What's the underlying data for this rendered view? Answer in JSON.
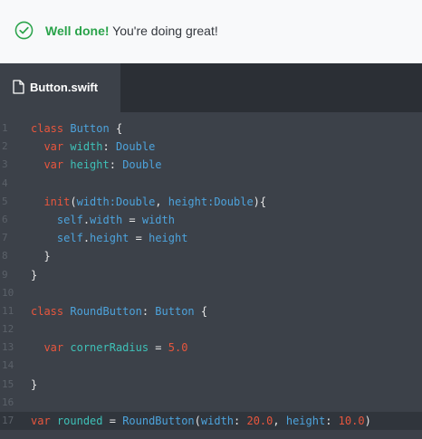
{
  "banner": {
    "strong": "Well done!",
    "message": " You're doing great!",
    "icon": "check-circle-icon",
    "accent_color": "#2aa34a"
  },
  "editor": {
    "tab": {
      "label": "Button.swift",
      "icon": "file-icon"
    },
    "active_line": 17,
    "lines": [
      {
        "n": "1",
        "tokens": [
          [
            "k",
            "class"
          ],
          [
            "p",
            " "
          ],
          [
            "t",
            "Button"
          ],
          [
            "p",
            " {"
          ]
        ]
      },
      {
        "n": "2",
        "tokens": [
          [
            "p",
            "  "
          ],
          [
            "k",
            "var"
          ],
          [
            "p",
            " "
          ],
          [
            "v",
            "width"
          ],
          [
            "p",
            ": "
          ],
          [
            "t",
            "Double"
          ]
        ]
      },
      {
        "n": "3",
        "tokens": [
          [
            "p",
            "  "
          ],
          [
            "k",
            "var"
          ],
          [
            "p",
            " "
          ],
          [
            "v",
            "height"
          ],
          [
            "p",
            ": "
          ],
          [
            "t",
            "Double"
          ]
        ]
      },
      {
        "n": "4",
        "tokens": []
      },
      {
        "n": "5",
        "tokens": [
          [
            "p",
            "  "
          ],
          [
            "k",
            "init"
          ],
          [
            "p",
            "("
          ],
          [
            "t",
            "width:Double"
          ],
          [
            "p",
            ", "
          ],
          [
            "t",
            "height:Double"
          ],
          [
            "p",
            "){"
          ]
        ]
      },
      {
        "n": "6",
        "tokens": [
          [
            "p",
            "    "
          ],
          [
            "t",
            "self"
          ],
          [
            "p",
            "."
          ],
          [
            "t",
            "width"
          ],
          [
            "p",
            " = "
          ],
          [
            "t",
            "width"
          ]
        ]
      },
      {
        "n": "7",
        "tokens": [
          [
            "p",
            "    "
          ],
          [
            "t",
            "self"
          ],
          [
            "p",
            "."
          ],
          [
            "t",
            "height"
          ],
          [
            "p",
            " = "
          ],
          [
            "t",
            "height"
          ]
        ]
      },
      {
        "n": "8",
        "tokens": [
          [
            "p",
            "  }"
          ]
        ]
      },
      {
        "n": "9",
        "tokens": [
          [
            "p",
            "}"
          ]
        ]
      },
      {
        "n": "10",
        "tokens": []
      },
      {
        "n": "11",
        "tokens": [
          [
            "k",
            "class"
          ],
          [
            "p",
            " "
          ],
          [
            "t",
            "RoundButton"
          ],
          [
            "p",
            ": "
          ],
          [
            "t",
            "Button"
          ],
          [
            "p",
            " {"
          ]
        ]
      },
      {
        "n": "12",
        "tokens": []
      },
      {
        "n": "13",
        "tokens": [
          [
            "p",
            "  "
          ],
          [
            "k",
            "var"
          ],
          [
            "p",
            " "
          ],
          [
            "v",
            "cornerRadius"
          ],
          [
            "p",
            " = "
          ],
          [
            "n",
            "5.0"
          ]
        ]
      },
      {
        "n": "14",
        "tokens": []
      },
      {
        "n": "15",
        "tokens": [
          [
            "p",
            "}"
          ]
        ]
      },
      {
        "n": "16",
        "tokens": []
      },
      {
        "n": "17",
        "tokens": [
          [
            "k",
            "var"
          ],
          [
            "p",
            " "
          ],
          [
            "v",
            "rounded"
          ],
          [
            "p",
            " = "
          ],
          [
            "t",
            "RoundButton"
          ],
          [
            "p",
            "("
          ],
          [
            "t",
            "width"
          ],
          [
            "p",
            ": "
          ],
          [
            "n",
            "20.0"
          ],
          [
            "p",
            ", "
          ],
          [
            "t",
            "height"
          ],
          [
            "p",
            ": "
          ],
          [
            "n",
            "10.0"
          ],
          [
            "p",
            ")"
          ]
        ]
      }
    ]
  }
}
